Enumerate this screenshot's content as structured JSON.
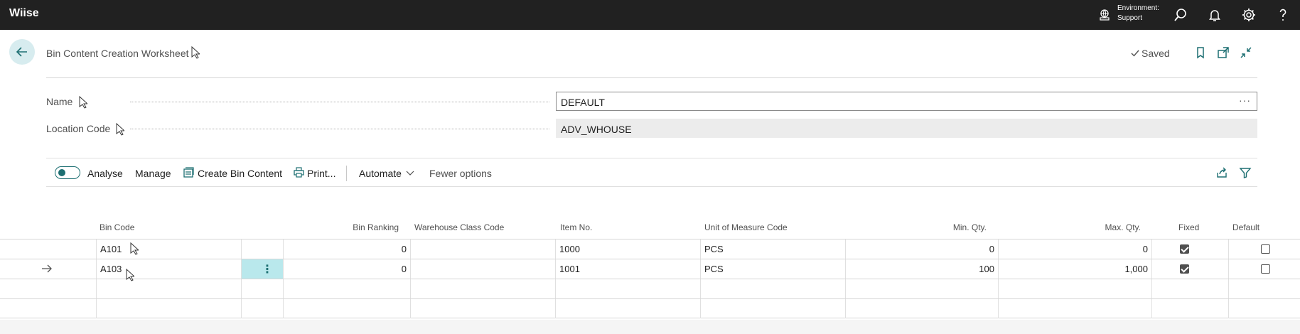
{
  "topbar": {
    "brand": "Wiise",
    "environment_label": "Environment:",
    "environment_value": "Support",
    "icons": [
      "environment-icon",
      "search-icon",
      "bell-icon",
      "gear-icon",
      "help-icon"
    ]
  },
  "header": {
    "title": "Bin Content Creation Worksheet",
    "saved_label": "Saved",
    "icons": [
      "back-icon",
      "bookmark-icon",
      "open-new-window-icon",
      "collapse-icon"
    ]
  },
  "fields": {
    "name_label": "Name",
    "name_value": "DEFAULT",
    "name_more": "···",
    "location_label": "Location Code",
    "location_value": "ADV_WHOUSE"
  },
  "actions": {
    "analyse": "Analyse",
    "analyse_on": false,
    "manage": "Manage",
    "create_bin_content": "Create Bin Content",
    "print": "Print...",
    "automate": "Automate",
    "fewer_options": "Fewer options"
  },
  "table": {
    "columns": {
      "bin_code": "Bin Code",
      "bin_ranking": "Bin Ranking",
      "warehouse_class_code": "Warehouse Class Code",
      "item_no": "Item No.",
      "uom": "Unit of Measure Code",
      "min_qty": "Min. Qty.",
      "max_qty": "Max. Qty.",
      "fixed": "Fixed",
      "default": "Default"
    },
    "rows": [
      {
        "bin_code": "A101",
        "bin_ranking": "0",
        "warehouse_class_code": "",
        "item_no": "1000",
        "uom": "PCS",
        "min_qty": "0",
        "max_qty": "0",
        "fixed": true,
        "default": false,
        "selected": false
      },
      {
        "bin_code": "A103",
        "bin_ranking": "0",
        "warehouse_class_code": "",
        "item_no": "1001",
        "uom": "PCS",
        "min_qty": "100",
        "max_qty": "1,000",
        "fixed": true,
        "default": false,
        "selected": true
      },
      {
        "bin_code": "",
        "bin_ranking": "",
        "warehouse_class_code": "",
        "item_no": "",
        "uom": "",
        "min_qty": "",
        "max_qty": "",
        "fixed": null,
        "default": null,
        "selected": false
      },
      {
        "bin_code": "",
        "bin_ranking": "",
        "warehouse_class_code": "",
        "item_no": "",
        "uom": "",
        "min_qty": "",
        "max_qty": "",
        "fixed": null,
        "default": null,
        "selected": false
      }
    ]
  },
  "colors": {
    "topbar": "#212121",
    "accent": "#1d6f72",
    "selected_cell": "#b9e8ec",
    "back_button": "#d7ecef"
  }
}
